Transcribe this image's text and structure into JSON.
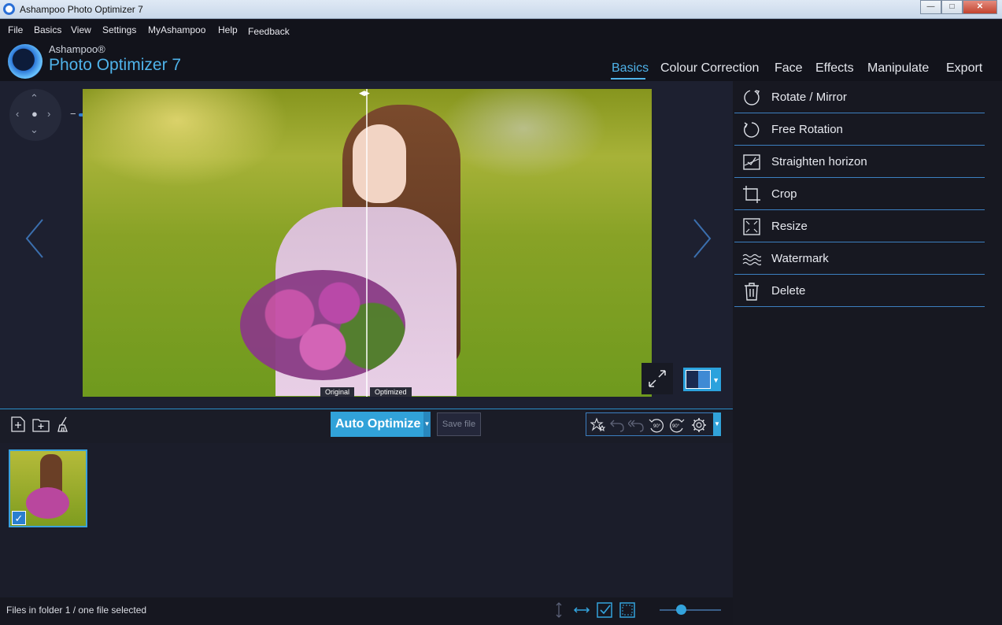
{
  "window": {
    "title": "Ashampoo Photo Optimizer 7"
  },
  "menu": [
    "File",
    "Basics",
    "View",
    "Settings",
    "MyAshampoo",
    "Help",
    "Feedback"
  ],
  "brand": {
    "small": "Ashampoo®",
    "big": "Photo Optimizer 7"
  },
  "tabs": [
    {
      "label": "Basics",
      "active": true
    },
    {
      "label": "Colour Correction",
      "active": false
    },
    {
      "label": "Face",
      "active": false
    },
    {
      "label": "Effects",
      "active": false
    },
    {
      "label": "Manipulate",
      "active": false
    },
    {
      "label": "Export",
      "active": false
    }
  ],
  "viewer": {
    "zoom_minus": "−",
    "zoom_plus": "+",
    "zoom_level": 0.32,
    "split_labels": {
      "original": "Original",
      "optimized": "Optimized"
    }
  },
  "panel": {
    "items": [
      {
        "label": "Rotate / Mirror",
        "icon": "rotate-mirror-icon"
      },
      {
        "label": "Free Rotation",
        "icon": "free-rotation-icon"
      },
      {
        "label": "Straighten horizon",
        "icon": "straighten-horizon-icon"
      },
      {
        "label": "Crop",
        "icon": "crop-icon"
      },
      {
        "label": "Resize",
        "icon": "resize-icon"
      },
      {
        "label": "Watermark",
        "icon": "watermark-icon"
      },
      {
        "label": "Delete",
        "icon": "trash-icon"
      }
    ]
  },
  "toolbar": {
    "auto_optimize": "Auto Optimize",
    "save_file": "Save file",
    "rotate_left_label": "90°",
    "rotate_right_label": "90°"
  },
  "status": {
    "text": "Files in folder 1 / one file selected",
    "thumb_size": 0.35
  },
  "colors": {
    "accent": "#31a2d9",
    "brand": "#4fb3ea",
    "background": "#1b1d2a"
  }
}
